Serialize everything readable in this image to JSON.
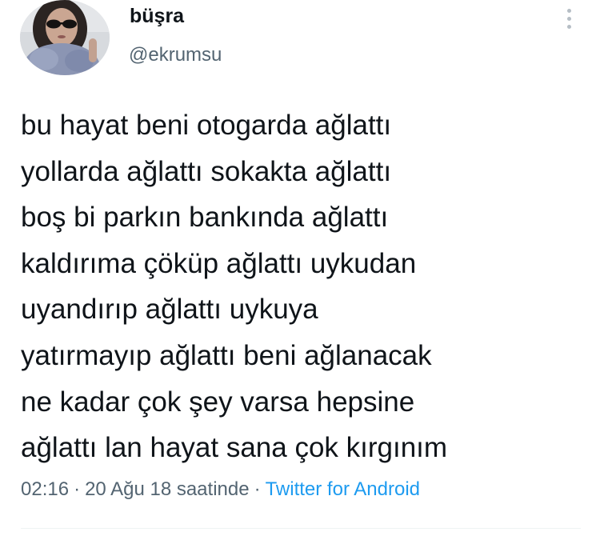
{
  "author": {
    "display_name": "büşra",
    "handle": "@ekrumsu"
  },
  "tweet": {
    "text": "bu hayat beni otogarda ağlattı\nyollarda ağlattı sokakta ağlattı\nboş bi parkın bankında ağlattı\nkaldırıma çöküp ağlattı uykudan\nuyandırıp ağlattı uykuya\nyatırmayıp ağlattı beni ağlanacak\nne kadar çok şey varsa hepsine\nağlattı lan hayat sana çok kırgınım"
  },
  "meta": {
    "time": "02:16",
    "separator_1": "·",
    "date": "20 Ağu 18 saatinde",
    "separator_2": "·",
    "source": "Twitter for Android"
  },
  "icons": {
    "more": "more-vertical-icon"
  },
  "colors": {
    "text": "#0f1419",
    "secondary": "#536471",
    "link": "#1d9bf0",
    "divider": "#eff3f4"
  }
}
